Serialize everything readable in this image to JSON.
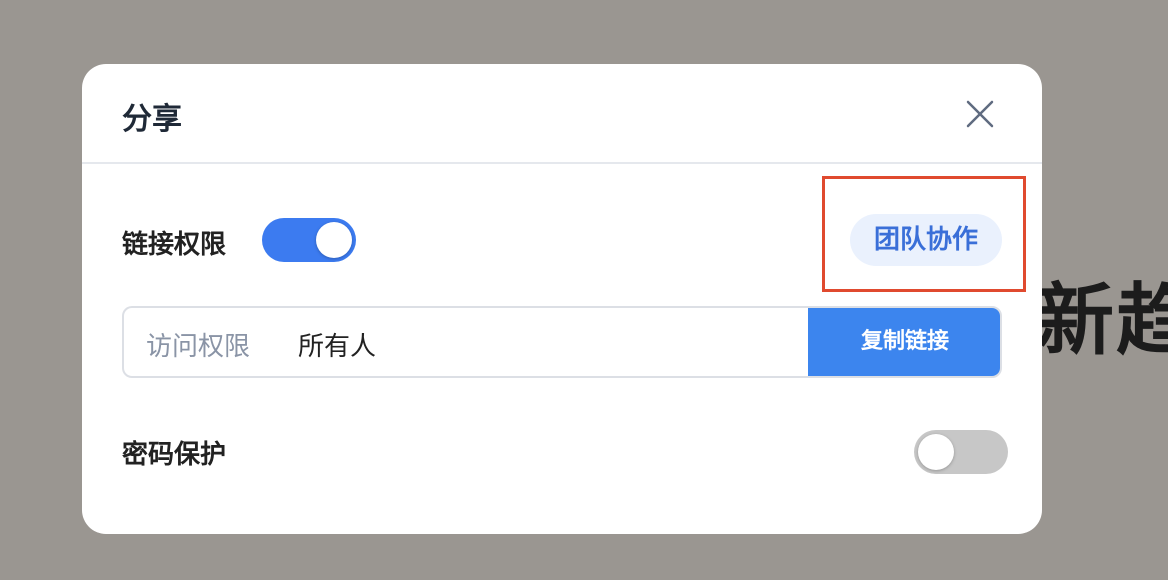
{
  "background": {
    "partial_text": "新趋"
  },
  "dialog": {
    "title": "分享",
    "close_icon": "close-icon",
    "link_permission": {
      "label": "链接权限",
      "enabled": true
    },
    "team_button": {
      "label": "团队协作"
    },
    "access": {
      "label": "访问权限",
      "value": "所有人",
      "copy_label": "复制链接"
    },
    "password": {
      "label": "密码保护",
      "enabled": false
    }
  },
  "colors": {
    "accent": "#3c7bf0",
    "highlight": "#e04a2f",
    "team_bg": "#eaf1fd",
    "overlay": "#9a9691"
  }
}
